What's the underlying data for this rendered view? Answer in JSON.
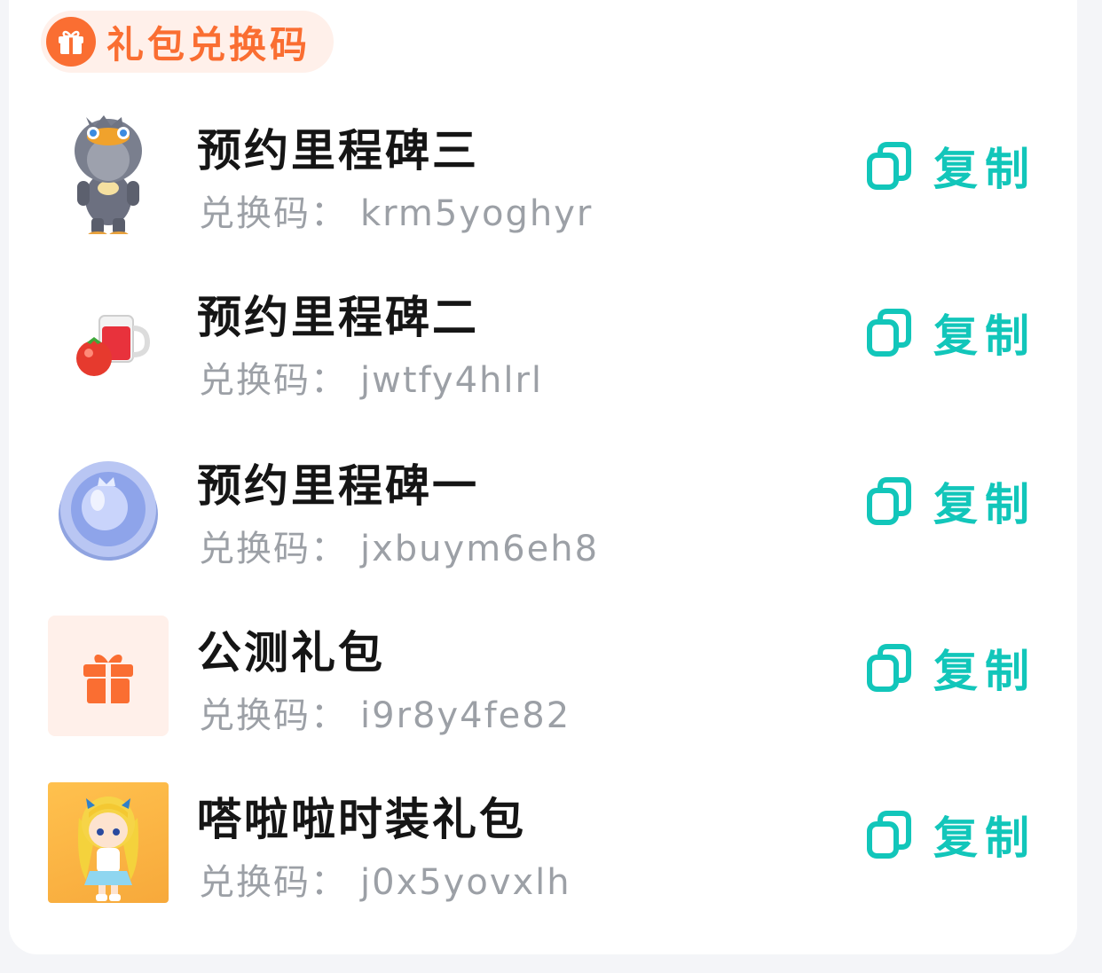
{
  "header": {
    "title": "礼包兑换码",
    "icon": "gift-icon",
    "accent_color": "#fa6e32"
  },
  "code_prefix": "兑换码：",
  "copy_label": "复制",
  "copy_color": "#12c6ba",
  "items": [
    {
      "title": "预约里程碑三",
      "code_label": "兑换码：",
      "code": "krm5yoghyr",
      "image": "penguin-costume-figure"
    },
    {
      "title": "预约里程碑二",
      "code_label": "兑换码：",
      "code": "jwtfy4hlrl",
      "image": "tomato-juice-mug"
    },
    {
      "title": "预约里程碑一",
      "code_label": "兑换码：",
      "code": "jxbuym6eh8",
      "image": "blue-coin"
    },
    {
      "title": "公测礼包",
      "code_label": "兑换码：",
      "code": "i9r8y4fe82",
      "image": "gift-icon"
    },
    {
      "title": "嗒啦啦时装礼包",
      "code_label": "兑换码：",
      "code": "j0x5yovxlh",
      "image": "girl-outfit-figure"
    }
  ]
}
